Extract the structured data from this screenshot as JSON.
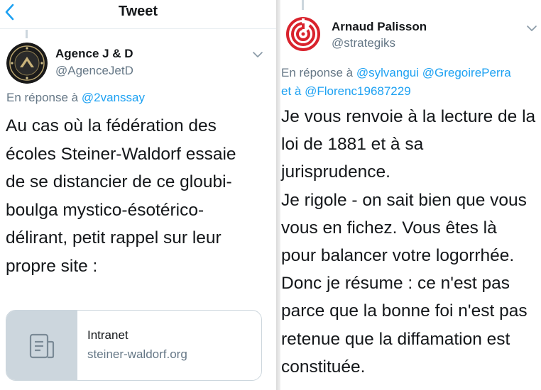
{
  "left_tweet": {
    "header_title": "Tweet",
    "author_name": "Agence J & D",
    "author_handle": "@AgenceJetD",
    "reply_prefix": "En réponse à",
    "reply_mention": "@2vanssay",
    "text_lines": [
      "Au cas où la fédération des",
      "écoles Steiner-Waldorf essaie",
      "de se distancier de ce gloubi-",
      "boulga mystico-ésotérico-",
      "délirant, petit rappel sur leur",
      "propre site :"
    ],
    "card": {
      "title": "Intranet",
      "domain": "steiner-waldorf.org",
      "icon": "article-icon"
    }
  },
  "right_tweet": {
    "author_name": "Arnaud Palisson",
    "author_handle": "@strategiks",
    "reply_prefix": "En réponse à",
    "reply_mention_1": "@sylvangui",
    "reply_mention_2": "@GregoirePerra",
    "reply_joiner": "et à",
    "reply_mention_3": "@Florenc19687229",
    "text_lines": [
      "Je vous renvoie à la lecture de la",
      "loi de 1881 et à sa",
      "jurisprudence.",
      "Je rigole - on sait bien que vous",
      "vous en fichez. Vous êtes là",
      "pour balancer votre logorrhée.",
      "Donc je résume : ce n'est pas",
      "parce que la bonne foi n'est pas",
      "retenue que la diffamation est",
      "constituée."
    ]
  },
  "colors": {
    "accent": "#1da1f2",
    "secondary_text": "#657786",
    "primary_text": "#14171a",
    "border": "#ccd6dd",
    "logo_red": "#d9232d"
  }
}
